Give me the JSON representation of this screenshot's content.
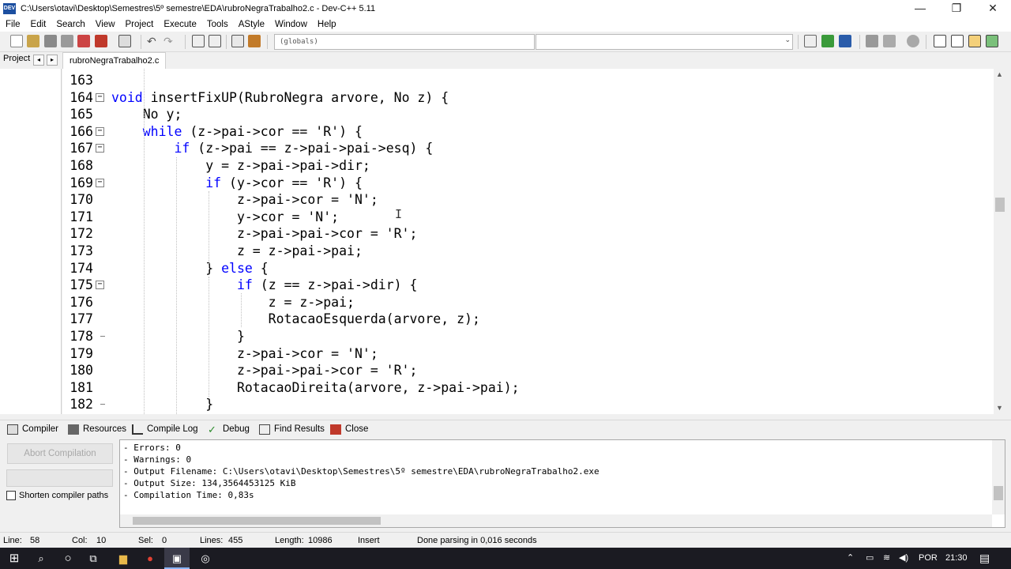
{
  "window": {
    "title": "C:\\Users\\otavi\\Desktop\\Semestres\\5º semestre\\EDA\\rubroNegraTrabalho2.c - Dev-C++ 5.11",
    "app_icon": "dev-cpp-icon",
    "minimize": "—",
    "restore": "❐",
    "close": "✕"
  },
  "menu": [
    "File",
    "Edit",
    "Search",
    "View",
    "Project",
    "Execute",
    "Tools",
    "AStyle",
    "Window",
    "Help"
  ],
  "toolbar": {
    "globals_combo": "(globals)",
    "icons": [
      "new-file-icon",
      "open-icon",
      "save-icon",
      "save-all-icon",
      "close-file-icon",
      "print-icon",
      "undo-icon",
      "redo-icon",
      "find-icon",
      "replace-icon",
      "goto-icon",
      "compile-run-icon",
      "compile-icon",
      "run-icon",
      "rebuild-icon",
      "back-icon",
      "forward-icon",
      "debug-icon",
      "layout-icons"
    ]
  },
  "tabs": {
    "project_tab": "Project",
    "prev": "◂",
    "next": "▸",
    "file_tab": "rubroNegraTrabalho2.c"
  },
  "editor": {
    "lines": [
      {
        "n": "163",
        "fold": "",
        "segs": [
          {
            "t": ""
          }
        ]
      },
      {
        "n": "164",
        "fold": "box",
        "segs": [
          {
            "t": "void",
            "k": 1
          },
          {
            "t": " insertFixUP(RubroNegra arvore, No z) {"
          }
        ]
      },
      {
        "n": "165",
        "fold": "",
        "segs": [
          {
            "t": "    No y;"
          }
        ]
      },
      {
        "n": "166",
        "fold": "box",
        "segs": [
          {
            "t": "    "
          },
          {
            "t": "while",
            "k": 1
          },
          {
            "t": " (z->pai->cor == 'R') {"
          }
        ]
      },
      {
        "n": "167",
        "fold": "box",
        "segs": [
          {
            "t": "        "
          },
          {
            "t": "if",
            "k": 1
          },
          {
            "t": " (z->pai == z->pai->pai->esq) {"
          }
        ]
      },
      {
        "n": "168",
        "fold": "",
        "segs": [
          {
            "t": "            y = z->pai->pai->dir;"
          }
        ]
      },
      {
        "n": "169",
        "fold": "box",
        "segs": [
          {
            "t": "            "
          },
          {
            "t": "if",
            "k": 1
          },
          {
            "t": " (y->cor == 'R') {"
          }
        ]
      },
      {
        "n": "170",
        "fold": "",
        "segs": [
          {
            "t": "                z->pai->cor = 'N';"
          }
        ]
      },
      {
        "n": "171",
        "fold": "",
        "segs": [
          {
            "t": "                y->cor = 'N';"
          }
        ]
      },
      {
        "n": "172",
        "fold": "",
        "segs": [
          {
            "t": "                z->pai->pai->cor = 'R';"
          }
        ]
      },
      {
        "n": "173",
        "fold": "",
        "segs": [
          {
            "t": "                z = z->pai->pai;"
          }
        ]
      },
      {
        "n": "174",
        "fold": "",
        "segs": [
          {
            "t": "            } "
          },
          {
            "t": "else",
            "k": 1
          },
          {
            "t": " {"
          }
        ]
      },
      {
        "n": "175",
        "fold": "box",
        "segs": [
          {
            "t": "                "
          },
          {
            "t": "if",
            "k": 1
          },
          {
            "t": " (z == z->pai->dir) {"
          }
        ]
      },
      {
        "n": "176",
        "fold": "",
        "segs": [
          {
            "t": "                    z = z->pai;"
          }
        ]
      },
      {
        "n": "177",
        "fold": "",
        "segs": [
          {
            "t": "                    RotacaoEsquerda(arvore, z);"
          }
        ]
      },
      {
        "n": "178",
        "fold": "end",
        "segs": [
          {
            "t": "                }"
          }
        ]
      },
      {
        "n": "179",
        "fold": "",
        "segs": [
          {
            "t": "                z->pai->cor = 'N';"
          }
        ]
      },
      {
        "n": "180",
        "fold": "",
        "segs": [
          {
            "t": "                z->pai->pai->cor = 'R';"
          }
        ]
      },
      {
        "n": "181",
        "fold": "",
        "segs": [
          {
            "t": "                RotacaoDireita(arvore, z->pai->pai);"
          }
        ]
      },
      {
        "n": "182",
        "fold": "end",
        "segs": [
          {
            "t": "            }"
          }
        ]
      }
    ]
  },
  "bottom_tabs": [
    {
      "label": "Compiler",
      "icon": "grid-icon"
    },
    {
      "label": "Resources",
      "icon": "resources-icon"
    },
    {
      "label": "Compile Log",
      "icon": "bar-chart-icon"
    },
    {
      "label": "Debug",
      "icon": "check-icon"
    },
    {
      "label": "Find Results",
      "icon": "find-results-icon"
    },
    {
      "label": "Close",
      "icon": "close-icon"
    }
  ],
  "compile_panel": {
    "abort_button": "Abort Compilation",
    "shorten_label": "Shorten compiler paths",
    "log": [
      "- Errors: 0",
      "- Warnings: 0",
      "- Output Filename: C:\\Users\\otavi\\Desktop\\Semestres\\5º semestre\\EDA\\rubroNegraTrabalho2.exe",
      "- Output Size: 134,3564453125 KiB",
      "- Compilation Time: 0,83s"
    ]
  },
  "status": {
    "line_label": "Line:",
    "line": "58",
    "col_label": "Col:",
    "col": "10",
    "sel_label": "Sel:",
    "sel": "0",
    "lines_label": "Lines:",
    "lines": "455",
    "length_label": "Length:",
    "length": "10986",
    "mode": "Insert",
    "message": "Done parsing in 0,016 seconds"
  },
  "taskbar": {
    "lang": "POR",
    "time": "21:30",
    "items": [
      "windows-start-icon",
      "search-icon",
      "cortana-icon",
      "task-view-icon",
      "file-explorer-icon",
      "chrome-icon",
      "devcpp-icon",
      "app-icon"
    ]
  },
  "colors": {
    "keyword": "#0000ff",
    "taskbar": "#1b1b22"
  }
}
